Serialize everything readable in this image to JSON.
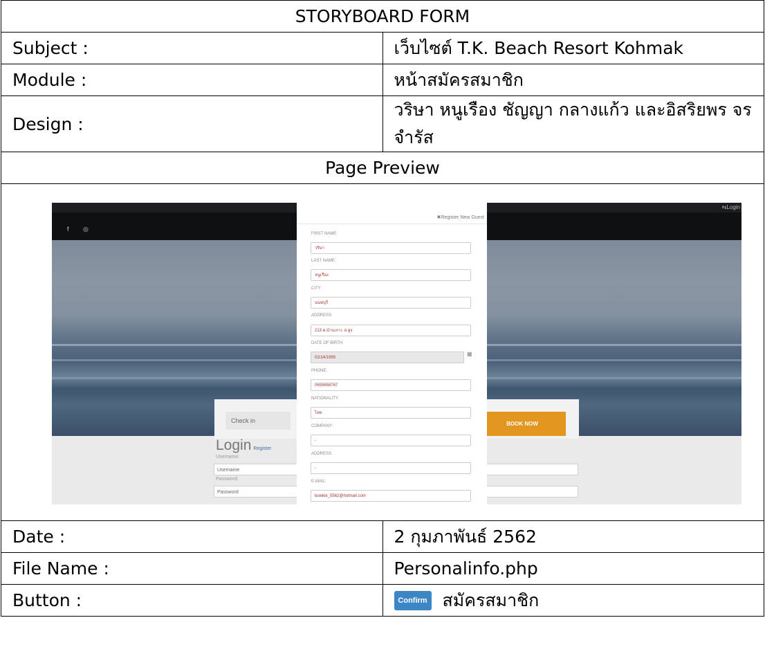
{
  "form_title": "STORYBOARD FORM",
  "rows": {
    "subject": {
      "label": "Subject :",
      "value": "เว็บไซต์ T.K. Beach Resort Kohmak"
    },
    "module": {
      "label": "Module :",
      "value": "หน้าสมัครสมาชิก"
    },
    "design": {
      "label": "Design :",
      "value": "วริษา หนูเรือง ชัญญา กลางแก้ว และอิสริยพร จรจำรัส"
    },
    "date": {
      "label": "Date :",
      "value": "2 กุมภาพันธ์ 2562"
    },
    "filename": {
      "label": "File Name :",
      "value": "Personalinfo.php"
    },
    "button": {
      "label": "Button :",
      "button_label": "Confirm",
      "value": "สมัครสมาชิก"
    }
  },
  "preview_heading": "Page Preview",
  "screenshot": {
    "top_login": "⇆Login",
    "social_icons": "f ◎",
    "check_in": "Check in",
    "book_now": "BOOK NOW",
    "login_title": "Login",
    "login_register": "Register",
    "username_label": "Username:",
    "username_placeholder": "Username",
    "password_label": "Password:",
    "password_placeholder": "Password",
    "modal": {
      "title": "✖Register New Guest",
      "fields": [
        {
          "label": "FIRST NAME:",
          "value": "วริษา"
        },
        {
          "label": "LAST NAME:",
          "value": "หนูเรือง"
        },
        {
          "label": "CITY:",
          "value": "นนทบุรี"
        },
        {
          "label": "ADDRESS:",
          "value": "213 ต.บ้านเกาะ อ.สูง"
        },
        {
          "label": "DATE OF BIRTH:",
          "value": "02/14/1995"
        },
        {
          "label": "PHONE:",
          "value": "0659658767"
        },
        {
          "label": "NATIONALITY:",
          "value": "ไทย"
        },
        {
          "label": "COMPANY:",
          "value": "-"
        },
        {
          "label": "ADDRESS:",
          "value": "-"
        },
        {
          "label": "E-MAIL:",
          "value": "bowkie_5562@hotmail.com"
        }
      ]
    }
  }
}
